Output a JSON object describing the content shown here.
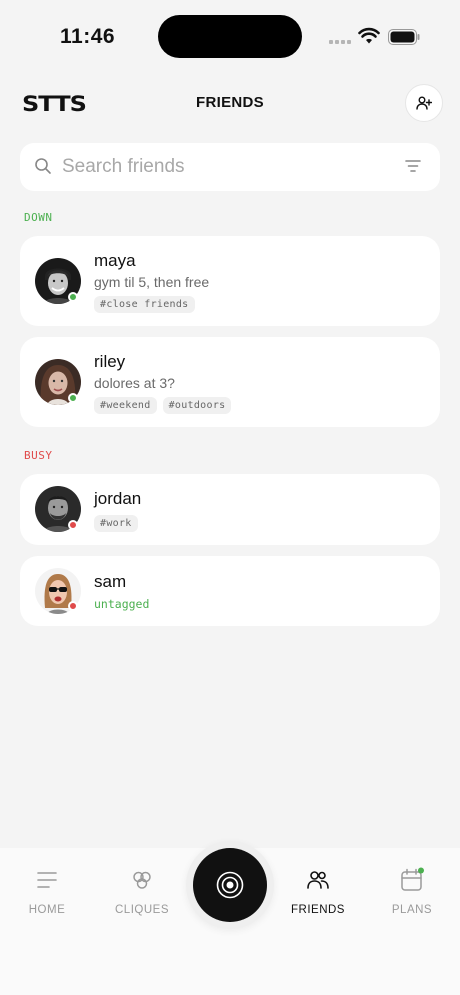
{
  "status_bar": {
    "time": "11:46"
  },
  "header": {
    "logo": "STTS",
    "title": "FRIENDS"
  },
  "search": {
    "placeholder": "Search friends",
    "value": ""
  },
  "sections": {
    "down": {
      "label": "DOWN",
      "color": "#4cb050"
    },
    "busy": {
      "label": "BUSY",
      "color": "#e04b4b"
    }
  },
  "friends": [
    {
      "name": "maya",
      "status": "gym til 5, then free",
      "tags": [
        "#close friends"
      ],
      "presence": "online"
    },
    {
      "name": "riley",
      "status": "dolores at 3?",
      "tags": [
        "#weekend",
        "#outdoors"
      ],
      "presence": "online"
    },
    {
      "name": "jordan",
      "status": "",
      "tags": [
        "#work"
      ],
      "presence": "busy"
    },
    {
      "name": "sam",
      "status": "",
      "tags": [],
      "untagged_label": "untagged",
      "presence": "busy"
    }
  ],
  "tabbar": {
    "home": "HOME",
    "cliques": "CLIQUES",
    "friends": "FRIENDS",
    "plans": "PLANS",
    "active": "friends"
  },
  "colors": {
    "online": "#4cb050",
    "busy": "#e04b4b",
    "accent": "#111111"
  },
  "icons": [
    "search-icon",
    "filter-icon",
    "add-friend-icon",
    "home-icon",
    "cliques-icon",
    "camera-icon",
    "friends-icon",
    "plans-icon"
  ]
}
